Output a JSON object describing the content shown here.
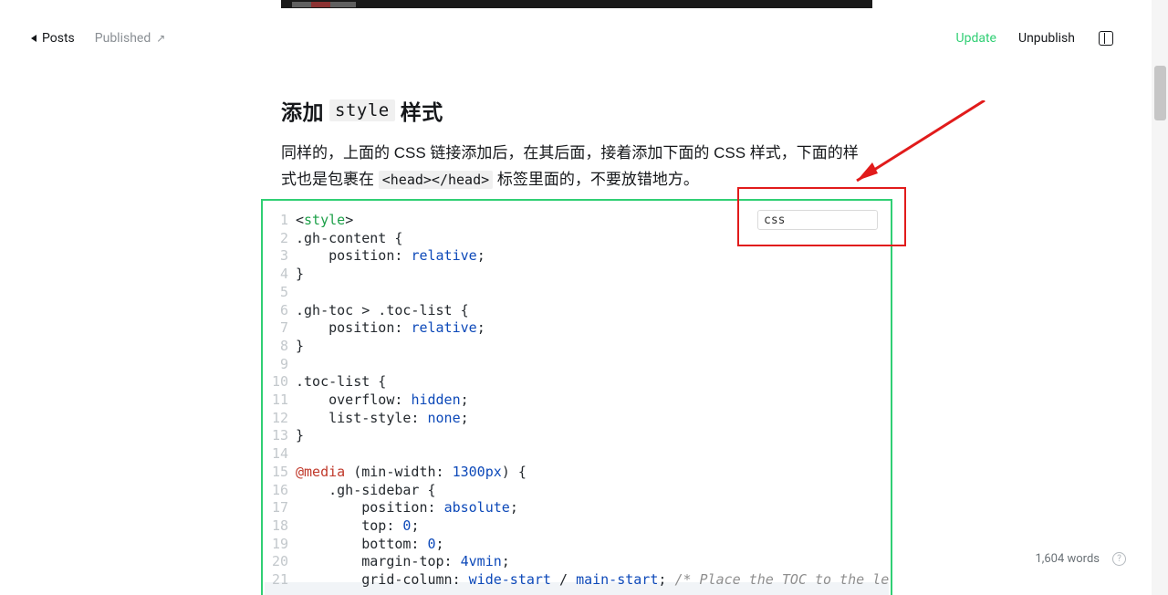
{
  "header": {
    "back_label": "Posts",
    "status_label": "Published",
    "update_label": "Update",
    "unpublish_label": "Unpublish"
  },
  "article": {
    "h2_pre": "添加",
    "h2_code": "style",
    "h2_post": "样式",
    "para_1a": "同样的，上面的 CSS 链接添加后，在其后面，接着添加下面的 CSS 样式，下面的样式也是包裹在 ",
    "para_1_code": "<head></head>",
    "para_1b": " 标签里面的，不要放错地方。"
  },
  "code_card": {
    "language_value": "css",
    "lines": {
      "l1": "<style>",
      "l2_sel": ".gh-content",
      "l2_brace": " {",
      "l3_prop": "    position: ",
      "l3_val": "relative",
      "l3_end": ";",
      "l4": "}",
      "l5": "",
      "l6_sel": ".gh-toc > .toc-list",
      "l6_brace": " {",
      "l7_prop": "    position: ",
      "l7_val": "relative",
      "l7_end": ";",
      "l8": "}",
      "l9": "",
      "l10_sel": ".toc-list",
      "l10_brace": " {",
      "l11_prop": "    overflow: ",
      "l11_val": "hidden",
      "l11_end": ";",
      "l12_prop": "    list-style: ",
      "l12_val": "none",
      "l12_end": ";",
      "l13": "}",
      "l14": "",
      "l15_a": "@media ",
      "l15_b": "(min-width: ",
      "l15_c": "1300px",
      "l15_d": ") {",
      "l16_sel": "    .gh-sidebar",
      "l16_brace": " {",
      "l17_prop": "        position: ",
      "l17_val": "absolute",
      "l17_end": ";",
      "l18_prop": "        top: ",
      "l18_val": "0",
      "l18_end": ";",
      "l19_prop": "        bottom: ",
      "l19_val": "0",
      "l19_end": ";",
      "l20_prop": "        margin-top: ",
      "l20_val": "4vmin",
      "l20_end": ";",
      "l21_prop": "        grid-column: ",
      "l21_val1": "wide-start",
      "l21_sep": " / ",
      "l21_val2": "main-start",
      "l21_end": "; ",
      "l21_comment": "/* Place the TOC to the left of the content */"
    }
  },
  "status": {
    "word_count": "1,604 words",
    "help_glyph": "?"
  },
  "chart_data": null
}
